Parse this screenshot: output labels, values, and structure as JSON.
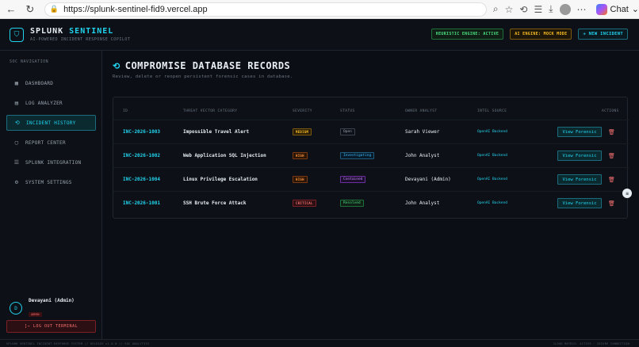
{
  "browser": {
    "url": "https://splunk-sentinel-fid9.vercel.app",
    "copilot_label": "Chat"
  },
  "header": {
    "brand_prefix": "SPLUNK",
    "brand_accent": "SENTINEL",
    "subtitle": "AI-POWERED INCIDENT RESPONSE COPILOT",
    "heuristic_pill": "HEURISTIC ENGINE: ACTIVE",
    "ai_pill": "AI ENGINE: MOCK MODE",
    "new_incident": "+ NEW INCIDENT"
  },
  "sidebar": {
    "title": "SOC NAVIGATION",
    "items": [
      {
        "label": "DASHBOARD",
        "icon": "grid-icon",
        "active": false
      },
      {
        "label": "LOG ANALYZER",
        "icon": "file-icon",
        "active": false
      },
      {
        "label": "INCIDENT HISTORY",
        "icon": "history-icon",
        "active": true
      },
      {
        "label": "REPORT CENTER",
        "icon": "book-icon",
        "active": false
      },
      {
        "label": "SPLUNK INTEGRATION",
        "icon": "database-icon",
        "active": false
      },
      {
        "label": "SYSTEM SETTINGS",
        "icon": "gear-icon",
        "active": false
      }
    ],
    "user": {
      "initial": "D",
      "name": "Devayani (Admin)",
      "role": "ADMIN"
    },
    "logout": "LOG OUT TERMINAL"
  },
  "main": {
    "title": "COMPROMISE DATABASE RECORDS",
    "subtitle": "Review, delete or reopen persistent forensic cases in database.",
    "columns": [
      "ID",
      "THREAT VECTOR CATEGORY",
      "SEVERITY",
      "STATUS",
      "OWNER ANALYST",
      "INTEL SOURCE",
      "ACTIONS"
    ],
    "rows": [
      {
        "id": "INC-2026-1003",
        "category": "Impossible Travel Alert",
        "severity": "MEDIUM",
        "status": "Open",
        "analyst": "Sarah Viewer",
        "intel": "OpenAI Backend",
        "action": "View Forensic"
      },
      {
        "id": "INC-2026-1002",
        "category": "Web Application SQL Injection",
        "severity": "HIGH",
        "status": "Investigating",
        "analyst": "John Analyst",
        "intel": "OpenAI Backend",
        "action": "View Forensic"
      },
      {
        "id": "INC-2026-1004",
        "category": "Linux Privilege Escalation",
        "severity": "HIGH",
        "status": "Contained",
        "analyst": "Devayani (Admin)",
        "intel": "OpenAI Backend",
        "action": "View Forensic"
      },
      {
        "id": "INC-2026-1001",
        "category": "SSH Brute Force Attack",
        "severity": "CRITICAL",
        "status": "Resolved",
        "analyst": "John Analyst",
        "intel": "OpenAI Backend",
        "action": "View Forensic"
      }
    ]
  },
  "footer": {
    "left": "SPLUNK SENTINEL INCIDENT RESPONSE SYSTEM // RELEASE v1.0.0 // SOC ANALYTICS",
    "right": "CLOUD MATRIX: ACTIVE · SECURE CONNECTION"
  }
}
